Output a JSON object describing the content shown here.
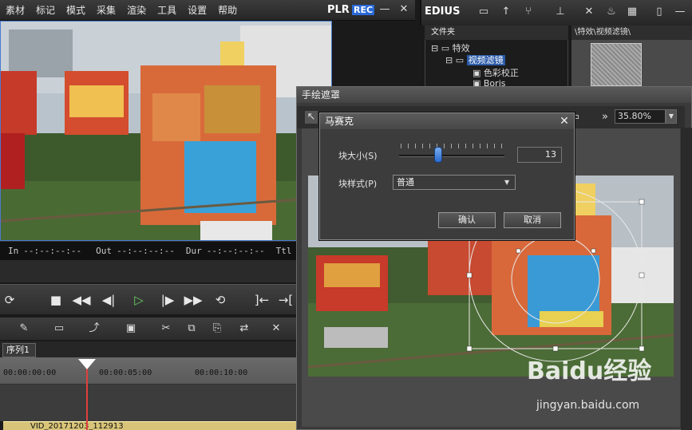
{
  "menubar": {
    "items": [
      "素材",
      "标记",
      "模式",
      "采集",
      "渲染",
      "工具",
      "设置",
      "帮助"
    ],
    "plr": "PLR",
    "rec": "REC"
  },
  "timecode": {
    "in_label": "In",
    "in_value": "--:--:--:--",
    "out_label": "Out",
    "out_value": "--:--:--:--",
    "dur_label": "Dur",
    "dur_value": "--:--:--:--",
    "ttl_label": "Ttl"
  },
  "timeline": {
    "sequence_tab": "序列1",
    "ticks": [
      "00:00:00:00",
      "00:00:05:00",
      "00:00:10:00"
    ],
    "clip_name": "VID_20171203_112913"
  },
  "bin": {
    "app_name": "EDIUS",
    "folder_header": "文件夹",
    "tree": [
      "特效",
      "视频滤镜",
      "色彩校正",
      "Boris"
    ],
    "path": "\\特效\\视频滤镜\\"
  },
  "mask_window": {
    "title": "手绘遮罩",
    "zoom": "35.80%"
  },
  "mosaic_dialog": {
    "title": "马赛克",
    "block_size_label": "块大小(S)",
    "block_size_value": "13",
    "block_size_level": 0.37,
    "block_style_label": "块样式(P)",
    "block_style_value": "普通",
    "ok": "确认",
    "cancel": "取消"
  },
  "watermark": {
    "brand": "Baidu经验",
    "url": "jingyan.baidu.com"
  },
  "colors": {
    "accent": "#2a6ad8",
    "clip": "#d8c478",
    "playhead": "#e04040"
  }
}
